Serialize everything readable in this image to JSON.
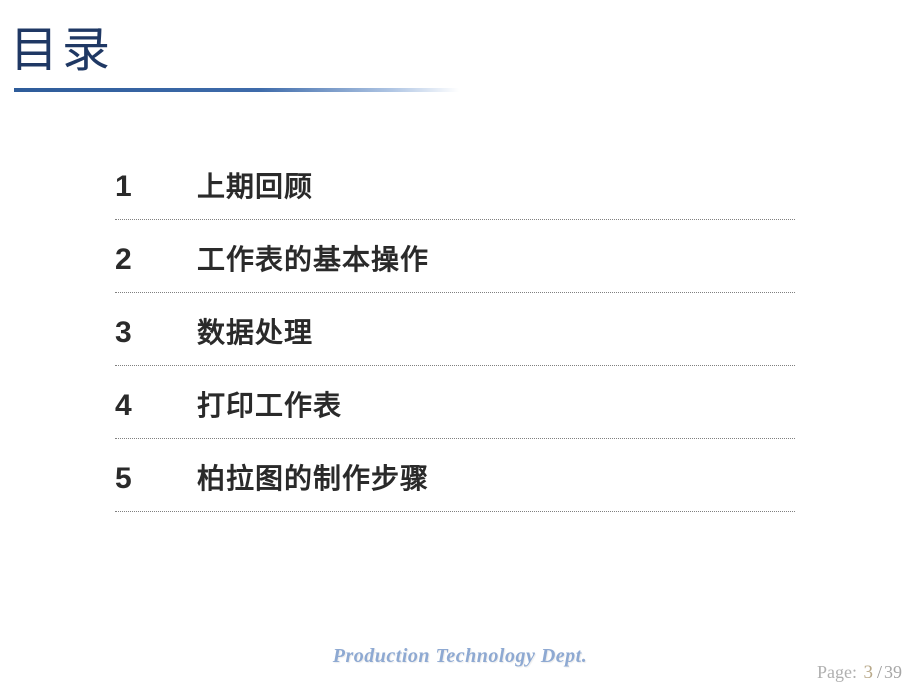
{
  "title": "目录",
  "toc": [
    {
      "num": "1",
      "label": "上期回顾"
    },
    {
      "num": "2",
      "label": "工作表的基本操作"
    },
    {
      "num": "3",
      "label": "数据处理"
    },
    {
      "num": "4",
      "label": "打印工作表"
    },
    {
      "num": "5",
      "label": "柏拉图的制作步骤"
    }
  ],
  "footer": {
    "department": "Production Technology Dept.",
    "page_label": "Page:",
    "current_page": "3",
    "separator": "/",
    "total_pages": "39"
  }
}
